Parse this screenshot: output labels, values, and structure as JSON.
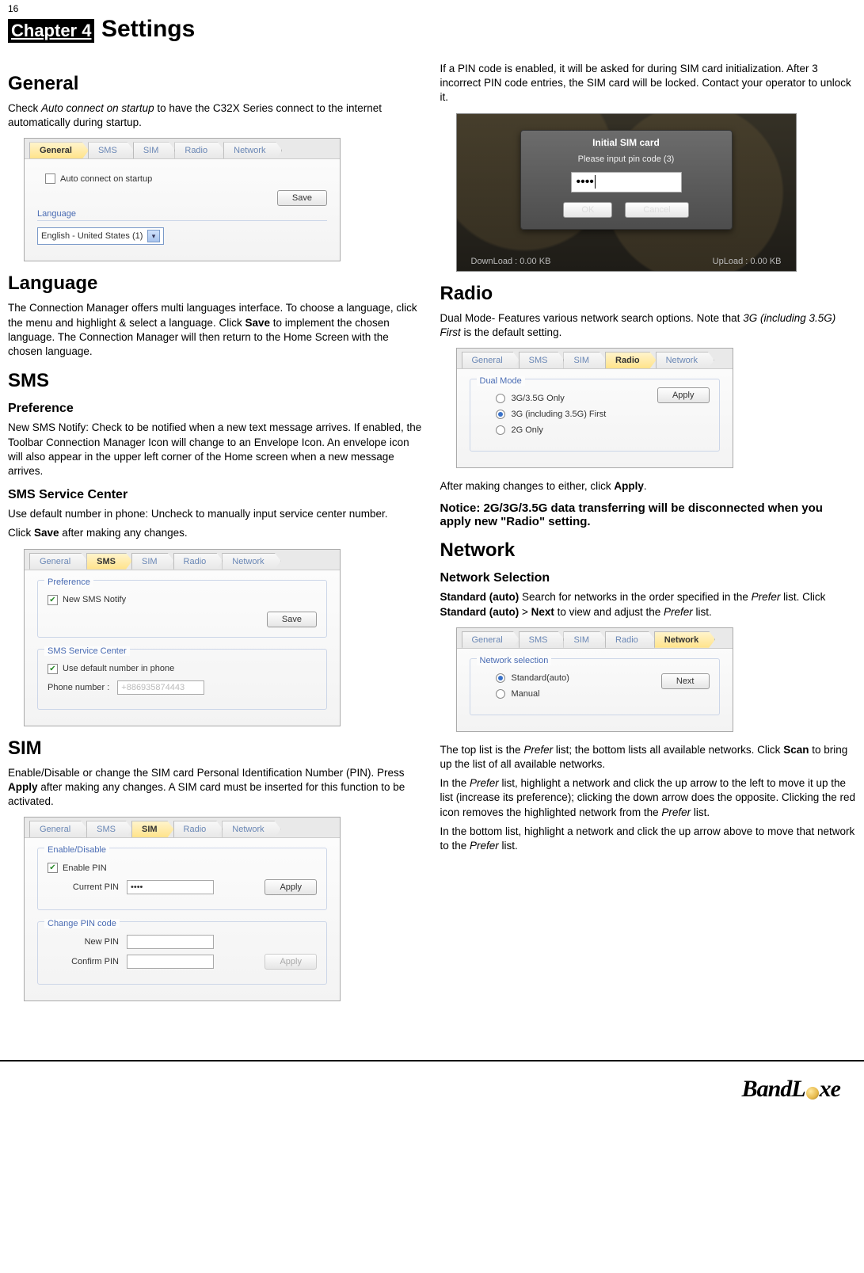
{
  "pageNumber": "16",
  "chapter": {
    "label": "Chapter 4",
    "title": "Settings"
  },
  "left": {
    "general": {
      "heading": "General",
      "p1a": "Check ",
      "p1i": "Auto connect on startup",
      "p1b": " to have the C32X Series connect to the internet automatically during startup.",
      "fig": {
        "tabs": {
          "general": "General",
          "sms": "SMS",
          "sim": "SIM",
          "radio": "Radio",
          "network": "Network"
        },
        "checkbox": "Auto connect on startup",
        "save": "Save",
        "langLabel": "Language",
        "select": "English - United States (1)"
      }
    },
    "language": {
      "heading": "Language",
      "p1a": "The Connection Manager offers multi languages interface. To choose a language, click the menu and highlight & select a language. Click ",
      "p1bold": "Save",
      "p1b": " to implement the chosen language. The Connection Manager will then return to the Home Screen with the chosen language."
    },
    "sms": {
      "heading": "SMS",
      "pref": {
        "sub": "Preference",
        "p": "New SMS Notify: Check to be notified when a new text message arrives. If enabled, the Toolbar Connection Manager Icon will change to an Envelope Icon. An envelope icon will also appear in the upper left corner of the Home screen when a new message arrives."
      },
      "center": {
        "sub": "SMS Service Center",
        "p1": "Use default number in phone: Uncheck to manually input service center number.",
        "p2a": "Click ",
        "p2bold": "Save",
        "p2b": " after making any changes."
      },
      "fig": {
        "tabs": {
          "general": "General",
          "sms": "SMS",
          "sim": "SIM",
          "radio": "Radio",
          "network": "Network"
        },
        "prefLabel": "Preference",
        "notify": "New SMS Notify",
        "save": "Save",
        "centerLabel": "SMS Service Center",
        "useDefault": "Use default number in phone",
        "phoneLabel": "Phone number :",
        "phoneVal": "+886935874443"
      }
    },
    "sim": {
      "heading": "SIM",
      "p1a": "Enable/Disable or change the SIM card Personal Identification Number (PIN). Press ",
      "p1bold": "Apply",
      "p1b": " after making any changes. A SIM card must be inserted for this function to be activated.",
      "fig": {
        "tabs": {
          "general": "General",
          "sms": "SMS",
          "sim": "SIM",
          "radio": "Radio",
          "network": "Network"
        },
        "enableLabel": "Enable/Disable",
        "enablePin": "Enable PIN",
        "currentPin": "Current PIN",
        "currentVal": "••••",
        "apply": "Apply",
        "changeLabel": "Change PIN code",
        "newPin": "New PIN",
        "confirmPin": "Confirm PIN",
        "apply2": "Apply"
      }
    }
  },
  "right": {
    "simNote": "If a PIN code is enabled, it will be asked for during SIM card initialization. After 3 incorrect PIN code entries, the SIM card will be locked. Contact your operator to unlock it.",
    "dialog": {
      "title": "Initial SIM card",
      "msg": "Please input pin code (3)",
      "pin": "••••",
      "ok": "OK",
      "cancel": "Cancel",
      "download": "DownLoad : 0.00 KB",
      "upload": "UpLoad : 0.00 KB"
    },
    "radio": {
      "heading": "Radio",
      "p1a": "Dual Mode- Features various network search options. Note that ",
      "p1i": "3G (including 3.5G) First",
      "p1b": " is the default setting.",
      "fig": {
        "tabs": {
          "general": "General",
          "sms": "SMS",
          "sim": "SIM",
          "radio": "Radio",
          "network": "Network"
        },
        "groupLabel": "Dual Mode",
        "opt1": "3G/3.5G Only",
        "opt2": "3G (including 3.5G) First",
        "opt3": "2G Only",
        "apply": "Apply"
      },
      "after_a": "After making changes to either, click ",
      "after_bold": "Apply",
      "after_b": ".",
      "notice": "Notice: 2G/3G/3.5G data transferring will be disconnected when you apply new \"Radio\" setting."
    },
    "network": {
      "heading": "Network",
      "sub": "Network Selection",
      "p1a": "Standard (auto)",
      "p1b": " Search for networks in the order specified in the ",
      "p1i1": "Prefer",
      "p1c": " list. Click ",
      "p1bold2": "Standard (auto)",
      "p1d": " > ",
      "p1bold3": "Next",
      "p1e": " to view and adjust the ",
      "p1i2": "Prefer",
      "p1f": " list.",
      "fig": {
        "tabs": {
          "general": "General",
          "sms": "SMS",
          "sim": "SIM",
          "radio": "Radio",
          "network": "Network"
        },
        "groupLabel": "Network selection",
        "opt1": "Standard(auto)",
        "opt2": "Manual",
        "next": "Next"
      },
      "p2a": "The top list is the ",
      "p2i1": "Prefer",
      "p2b": " list; the bottom lists all available networks. Click ",
      "p2bold": "Scan",
      "p2c": " to bring up the list of all available networks.",
      "p3a": "In the ",
      "p3i1": "Prefer",
      "p3b": " list, highlight a network and click the up arrow to the left to move it up the list (increase its preference); clicking the down arrow does the opposite. Clicking the red icon removes the highlighted network from the ",
      "p3i2": "Prefer",
      "p3c": " list.",
      "p4a": "In the bottom list, highlight a network and click the up arrow above to move that network to the ",
      "p4i": "Prefer",
      "p4b": " list."
    }
  },
  "brand": {
    "pre": "BandL",
    "post": "xe"
  }
}
